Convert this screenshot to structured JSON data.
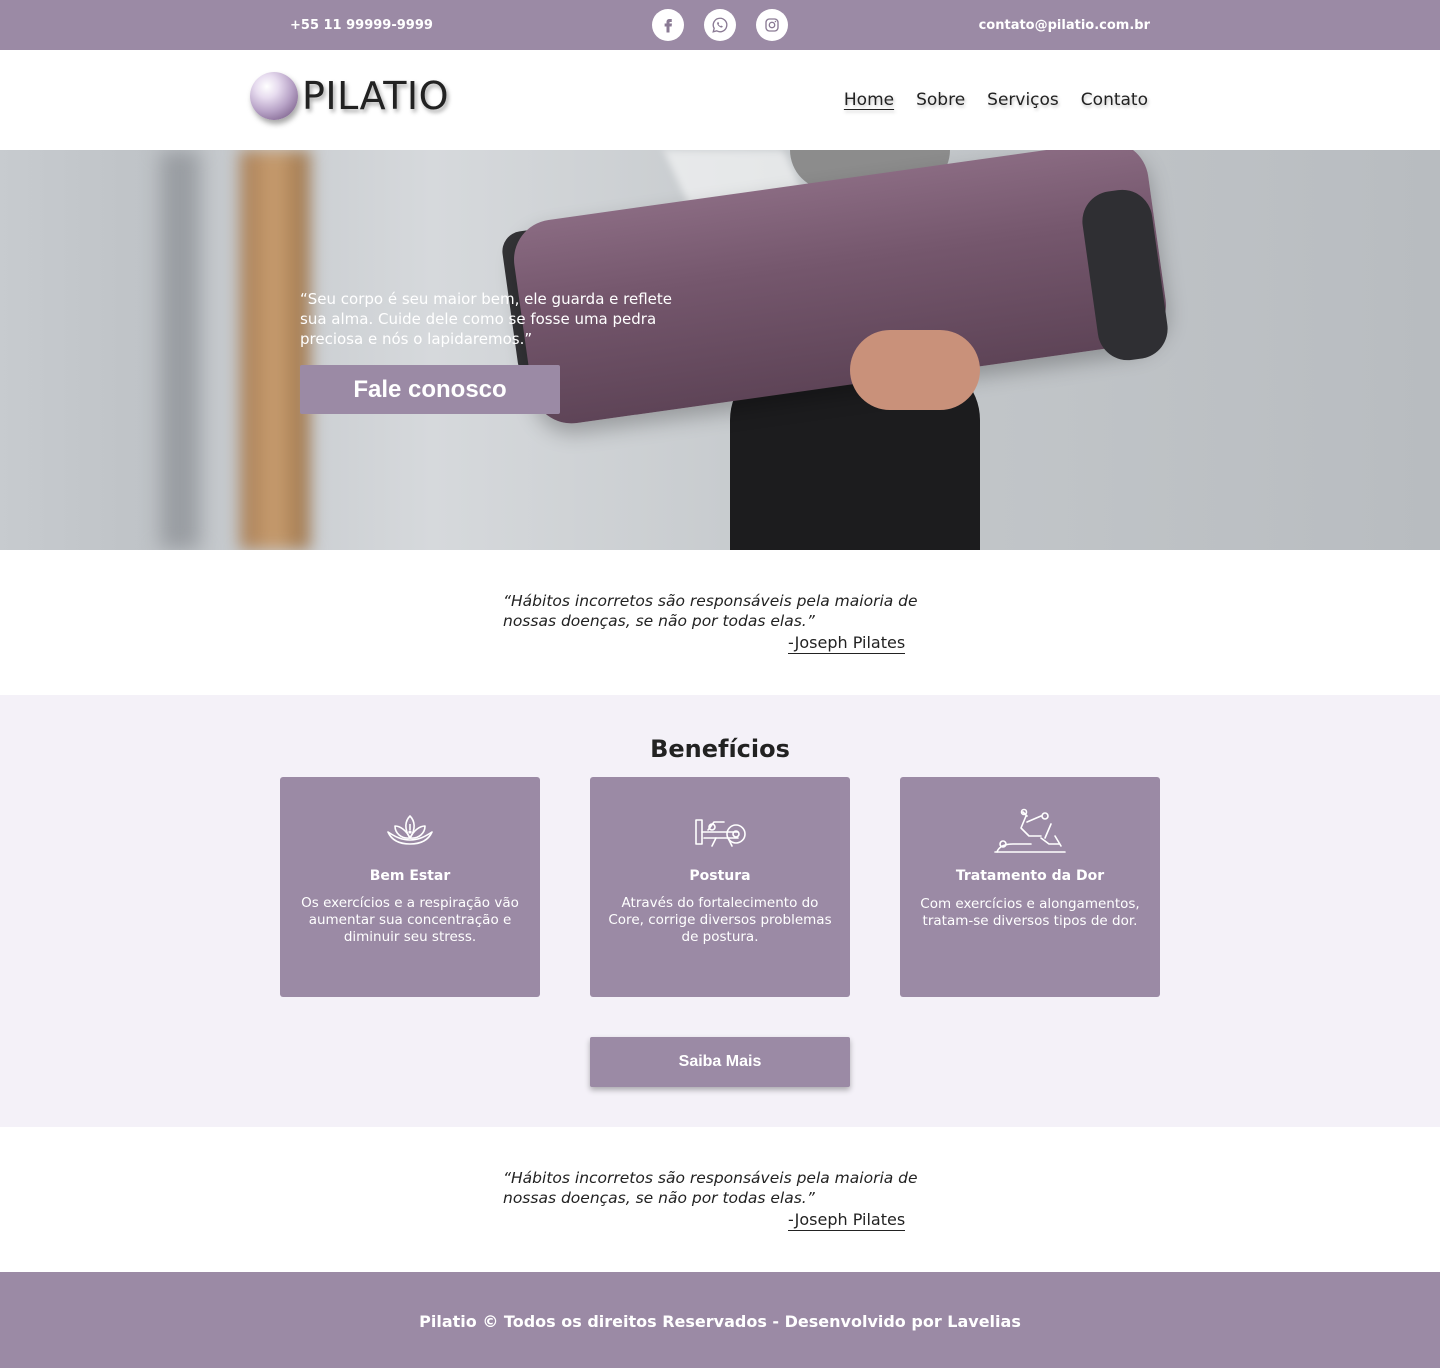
{
  "topbar": {
    "phone": "+55 11 99999-9999",
    "email": "contato@pilatio.com.br",
    "socials": [
      {
        "icon": "facebook-icon"
      },
      {
        "icon": "whatsapp-icon"
      },
      {
        "icon": "instagram-icon"
      }
    ]
  },
  "header": {
    "logo_text": "PILATIO",
    "nav": [
      "Home",
      "Sobre",
      "Serviços",
      "Contato"
    ],
    "active_nav": "Home"
  },
  "hero": {
    "quote": "“Seu corpo é seu maior bem, ele guarda e reflete sua alma. Cuide dele como se fosse uma pedra preciosa e nós o lapidaremos.”",
    "cta_label": "Fale conosco"
  },
  "quote1": {
    "text": "“Hábitos incorretos são responsáveis pela maioria de nossas doenças, se não por todas elas.”",
    "author": "-Joseph Pilates"
  },
  "benefits": {
    "title": "Benefícios",
    "cards": [
      {
        "icon": "lotus-icon",
        "title": "Bem Estar",
        "text": "Os exercícios e a respiração vão aumentar sua concentração e diminuir seu stress."
      },
      {
        "icon": "posture-machine-icon",
        "title": "Postura",
        "text": "Através do fortalecimento do Core, corrige diversos problemas de postura."
      },
      {
        "icon": "pain-treatment-icon",
        "title": "Tratamento da Dor",
        "text": "Com exercícios e alongamentos, tratam-se diversos tipos de dor."
      }
    ],
    "button_label": "Saiba Mais"
  },
  "quote2": {
    "text": "“Hábitos incorretos são responsáveis pela maioria de nossas doenças, se não por todas elas.”",
    "author": "-Joseph Pilates"
  },
  "footer": {
    "text": "Pilatio © Todos os direitos Reservados - Desenvolvido por Lavelias"
  },
  "colors": {
    "brand": "#9b8aa5",
    "benefits_bg": "#f4f1f8"
  }
}
